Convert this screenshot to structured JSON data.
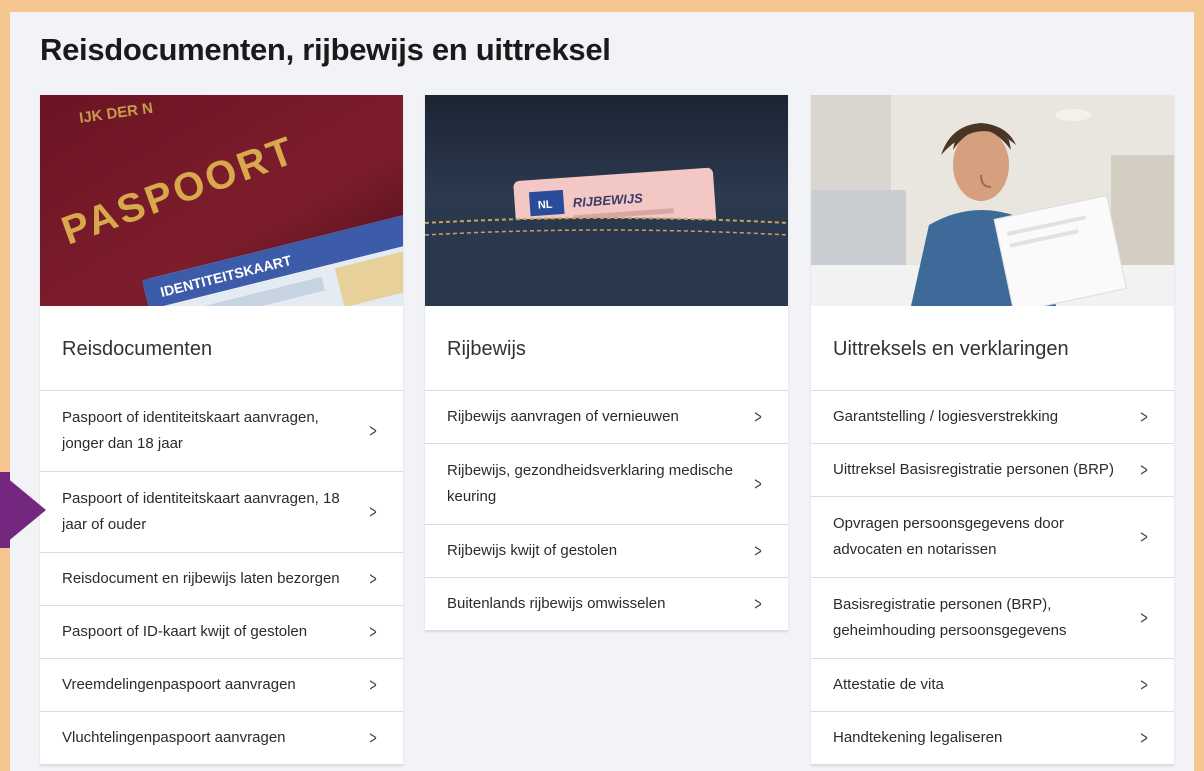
{
  "page_title": "Reisdocumenten, rijbewijs en uittreksel",
  "cards": [
    {
      "heading": "Reisdocumenten",
      "image_icon": "passport-photo",
      "image_text": {
        "line1": "PASPOORT",
        "line2": "IDENTITEITSKAART",
        "arc": "IJK DER N"
      },
      "links": [
        "Paspoort of identiteitskaart aanvragen, jonger dan 18 jaar",
        "Paspoort of identiteitskaart aanvragen, 18 jaar of ouder",
        "Reisdocument en rijbewijs laten bezorgen",
        "Paspoort of ID-kaart kwijt of gestolen",
        "Vreemdelingenpaspoort aanvragen",
        "Vluchtelingenpaspoort aanvragen"
      ]
    },
    {
      "heading": "Rijbewijs",
      "image_icon": "driving-license-in-pocket-photo",
      "image_text": {
        "label": "RIJBEWIJS",
        "country": "NL"
      },
      "links": [
        "Rijbewijs aanvragen of vernieuwen",
        "Rijbewijs, gezondheidsverklaring medische keuring",
        "Rijbewijs kwijt of gestolen",
        "Buitenlands rijbewijs omwisselen"
      ]
    },
    {
      "heading": "Uittreksels en verklaringen",
      "image_icon": "man-reading-document-photo",
      "links": [
        "Garantstelling / logiesverstrekking",
        "Uittreksel Basisregistratie personen (BRP)",
        "Opvragen persoonsgegevens door advocaten en notarissen",
        "Basisregistratie personen (BRP), geheimhouding persoonsgegevens",
        "Attestatie de vita",
        "Handtekening legaliseren"
      ]
    }
  ],
  "chevron_glyph": ">",
  "colors": {
    "frame_border": "#f6c690",
    "background": "#f1f3f7",
    "marker": "#74277f"
  }
}
